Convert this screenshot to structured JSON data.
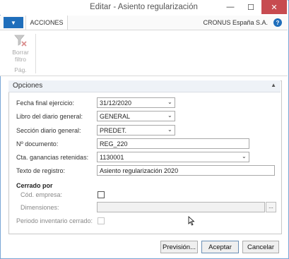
{
  "window": {
    "title": "Editar - Asiento regularización",
    "minimize_glyph": "—",
    "maximize_glyph": "☐",
    "close_glyph": "✕"
  },
  "ribbon": {
    "app_menu_glyph": "▼",
    "tab_actions": "ACCIONES",
    "company": "CRONUS España S.A.",
    "help_glyph": "?",
    "clear_filter_line1": "Borrar",
    "clear_filter_line2": "filtro",
    "group_label": "Pág."
  },
  "options": {
    "title": "Opciones",
    "collapse_glyph": "▲",
    "fields": {
      "fecha_final": {
        "label": "Fecha final ejercicio:",
        "value": "31/12/2020"
      },
      "libro": {
        "label": "Libro del diario general:",
        "value": "GENERAL"
      },
      "seccion": {
        "label": "Sección diario general:",
        "value": "PREDET."
      },
      "documento": {
        "label": "Nº documento:",
        "value": "REG_220"
      },
      "cta": {
        "label": "Cta. ganancias retenidas:",
        "value": "1130001"
      },
      "texto": {
        "label": "Texto de registro:",
        "value": "Asiento regularización 2020"
      }
    },
    "closed_by": {
      "title": "Cerrado por",
      "cod_empresa_label": "Cód. empresa:",
      "cod_empresa_checked": false,
      "dimensiones_label": "Dimensiones:",
      "dimensiones_value": "",
      "ellipsis_label": "...",
      "periodo_label": "Periodo inventario cerrado:",
      "periodo_checked": false
    }
  },
  "buttons": {
    "preview": "Previsión...",
    "accept": "Aceptar",
    "cancel": "Cancelar"
  },
  "colors": {
    "accent": "#1f6ebb",
    "close_button": "#c74b50",
    "panel_header": "#eef2f7"
  },
  "icons": {
    "clear_filter": "funnel-x-icon",
    "dropdown": "chevron-down-icon",
    "cursor": "mouse-pointer-icon"
  }
}
